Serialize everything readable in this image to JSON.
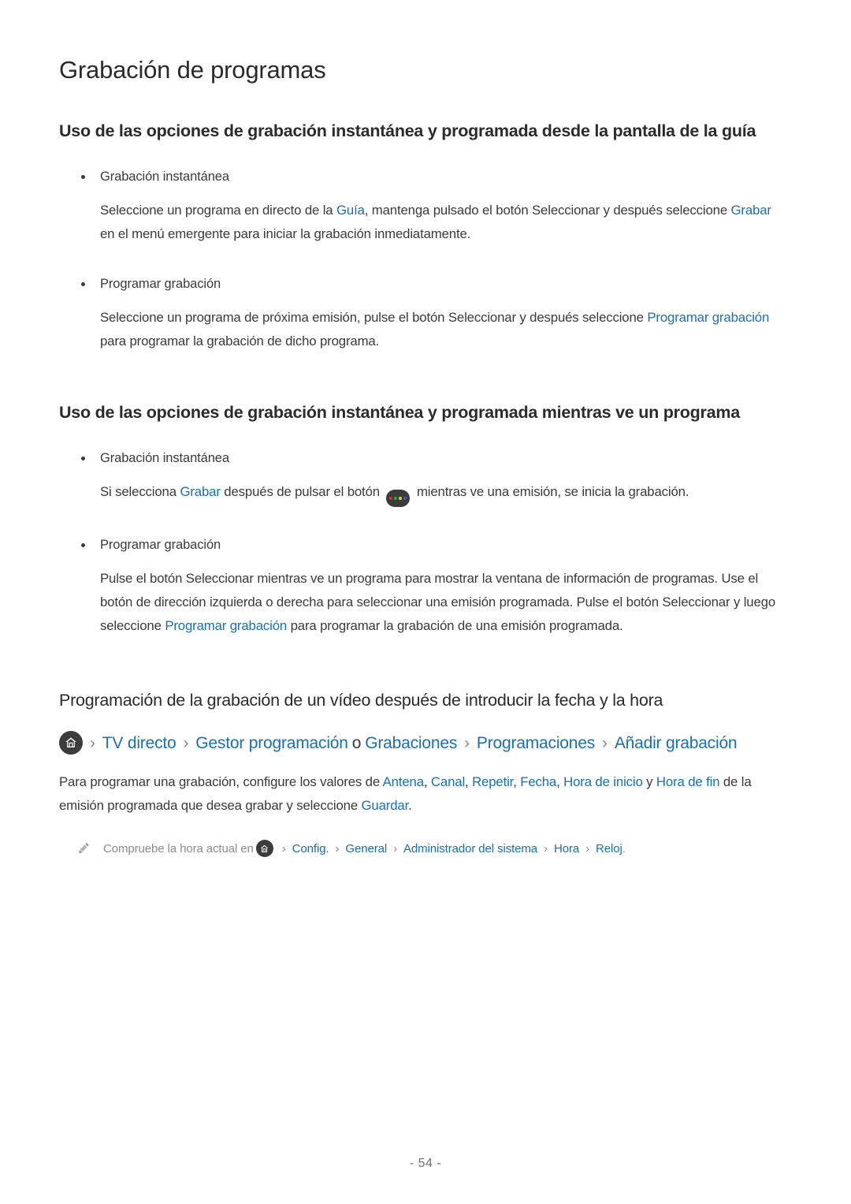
{
  "page": {
    "title": "Grabación de programas",
    "footer": "- 54 -"
  },
  "colors": {
    "link": "#1a6fb5",
    "text": "#3a3a3a",
    "heading": "#2b2b2b",
    "note": "#8c8c8c",
    "separator": "#8a8a8a",
    "icon_background": "#3c3c3c",
    "button_dot_red": "#e03127",
    "button_dot_green": "#2aa635",
    "button_dot_yellow": "#e7c93a",
    "button_dot_blue": "#2f5fbf"
  },
  "sections": [
    {
      "heading": "Uso de las opciones de grabación instantánea y programada desde la pantalla de la guía",
      "bullets": [
        {
          "label": "Grabación instantánea",
          "paragraph": {
            "part1": "Seleccione un programa en directo de la ",
            "link1": "Guía",
            "part2": ", mantenga pulsado el botón Seleccionar y después seleccione ",
            "link2": "Grabar",
            "part3": " en el menú emergente para iniciar la grabación inmediatamente."
          }
        },
        {
          "label": "Programar grabación",
          "paragraph": {
            "part1": "Seleccione un programa de próxima emisión, pulse el botón Seleccionar y después seleccione ",
            "link1": "Programar grabación",
            "part2": " para programar la grabación de dicho programa."
          }
        }
      ]
    },
    {
      "heading": "Uso de las opciones de grabación instantánea y programada mientras ve un programa",
      "bullets": [
        {
          "label": "Grabación instantánea",
          "paragraph": {
            "part1": "Si selecciona ",
            "link1": "Grabar",
            "part2": " después de pulsar el botón ",
            "icon": "color-button-icon",
            "part3": " mientras ve una emisión, se inicia la grabación."
          }
        },
        {
          "label": "Programar grabación",
          "paragraph": {
            "part1": "Pulse el botón Seleccionar mientras ve un programa para mostrar la ventana de información de programas. Use el botón de dirección izquierda o derecha para seleccionar una emisión programada. Pulse el botón Seleccionar y luego seleccione ",
            "link1": "Programar grabación",
            "part2": " para programar la grabación de una emisión programada."
          }
        }
      ]
    }
  ],
  "section3": {
    "heading": "Programación de la grabación de un vídeo después de introducir la fecha y la hora",
    "breadcrumb": {
      "home_icon": "home-icon",
      "items": [
        {
          "label": "TV directo",
          "type": "link"
        },
        {
          "label": "Gestor programación",
          "type": "link"
        },
        {
          "label": "o",
          "type": "plain"
        },
        {
          "label": "Grabaciones",
          "type": "link"
        },
        {
          "label": "Programaciones",
          "type": "link"
        },
        {
          "label": "Añadir grabación",
          "type": "link"
        }
      ],
      "separator": "›"
    },
    "paragraph": {
      "part1": "Para programar una grabación, configure los valores de ",
      "link1": "Antena",
      "sep1": ", ",
      "link2": "Canal",
      "sep2": ", ",
      "link3": "Repetir",
      "sep3": ", ",
      "link4": "Fecha",
      "sep4": ", ",
      "link5": "Hora de inicio",
      "sep5": " y ",
      "link6": "Hora de fin",
      "part2": " de la emisión programada que desea grabar y seleccione ",
      "link7": "Guardar",
      "part3": "."
    },
    "note": {
      "icon": "pencil-icon",
      "text": "Compruebe la hora actual en",
      "home_icon": "home-icon",
      "items": [
        {
          "label": "Config."
        },
        {
          "label": "General"
        },
        {
          "label": "Administrador del sistema"
        },
        {
          "label": "Hora"
        },
        {
          "label": "Reloj"
        }
      ],
      "separator": "›",
      "period": "."
    }
  }
}
